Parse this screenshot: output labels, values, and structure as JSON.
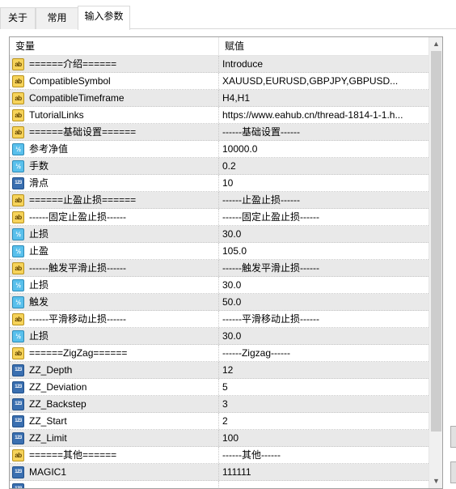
{
  "tabs": [
    {
      "label": "关于",
      "active": false
    },
    {
      "label": "常用",
      "active": false
    },
    {
      "label": "输入参数",
      "active": true
    }
  ],
  "table": {
    "columns": {
      "variable": "变量",
      "value": "赋值"
    },
    "rows": [
      {
        "icon": "ab",
        "name": "======介绍======",
        "value": "Introduce"
      },
      {
        "icon": "ab",
        "name": "CompatibleSymbol",
        "value": "XAUUSD,EURUSD,GBPJPY,GBPUSD..."
      },
      {
        "icon": "ab",
        "name": "CompatibleTimeframe",
        "value": "H4,H1"
      },
      {
        "icon": "ab",
        "name": "TutorialLinks",
        "value": "https://www.eahub.cn/thread-1814-1-1.h..."
      },
      {
        "icon": "ab",
        "name": "======基础设置======",
        "value": "------基础设置------"
      },
      {
        "icon": "v2",
        "name": "参考净值",
        "value": "10000.0"
      },
      {
        "icon": "v2",
        "name": "手数",
        "value": "0.2"
      },
      {
        "icon": "123",
        "name": "滑点",
        "value": "10"
      },
      {
        "icon": "ab",
        "name": "======止盈止损======",
        "value": "------止盈止损------"
      },
      {
        "icon": "ab",
        "name": "------固定止盈止损------",
        "value": "------固定止盈止损------"
      },
      {
        "icon": "v2",
        "name": "止损",
        "value": "30.0"
      },
      {
        "icon": "v2",
        "name": "止盈",
        "value": "105.0"
      },
      {
        "icon": "ab",
        "name": "------触发平滑止损------",
        "value": "------触发平滑止损------"
      },
      {
        "icon": "v2",
        "name": "止损",
        "value": "30.0"
      },
      {
        "icon": "v2",
        "name": "触发",
        "value": "50.0"
      },
      {
        "icon": "ab",
        "name": "------平滑移动止损------",
        "value": "------平滑移动止损------"
      },
      {
        "icon": "v2",
        "name": "止损",
        "value": "30.0"
      },
      {
        "icon": "ab",
        "name": "======ZigZag======",
        "value": "------Zigzag------"
      },
      {
        "icon": "123",
        "name": "ZZ_Depth",
        "value": "12"
      },
      {
        "icon": "123",
        "name": "ZZ_Deviation",
        "value": "5"
      },
      {
        "icon": "123",
        "name": "ZZ_Backstep",
        "value": "3"
      },
      {
        "icon": "123",
        "name": "ZZ_Start",
        "value": "2"
      },
      {
        "icon": "123",
        "name": "ZZ_Limit",
        "value": "100"
      },
      {
        "icon": "ab",
        "name": "======其他======",
        "value": "------其他------"
      },
      {
        "icon": "123",
        "name": "MAGIC1",
        "value": "111111"
      },
      {
        "icon": "123",
        "name": "",
        "value": ""
      }
    ]
  },
  "icons": {
    "ab": {
      "text": "ab",
      "semantic": "string-type-icon"
    },
    "v2": {
      "text": "½",
      "semantic": "double-type-icon"
    },
    "123": {
      "text": "123",
      "semantic": "integer-type-icon"
    }
  },
  "colors": {
    "row_alt": "#e9e9e9",
    "string_icon": "#f6d35a",
    "double_icon": "#59c0ec",
    "integer_icon": "#3a6fb0"
  }
}
